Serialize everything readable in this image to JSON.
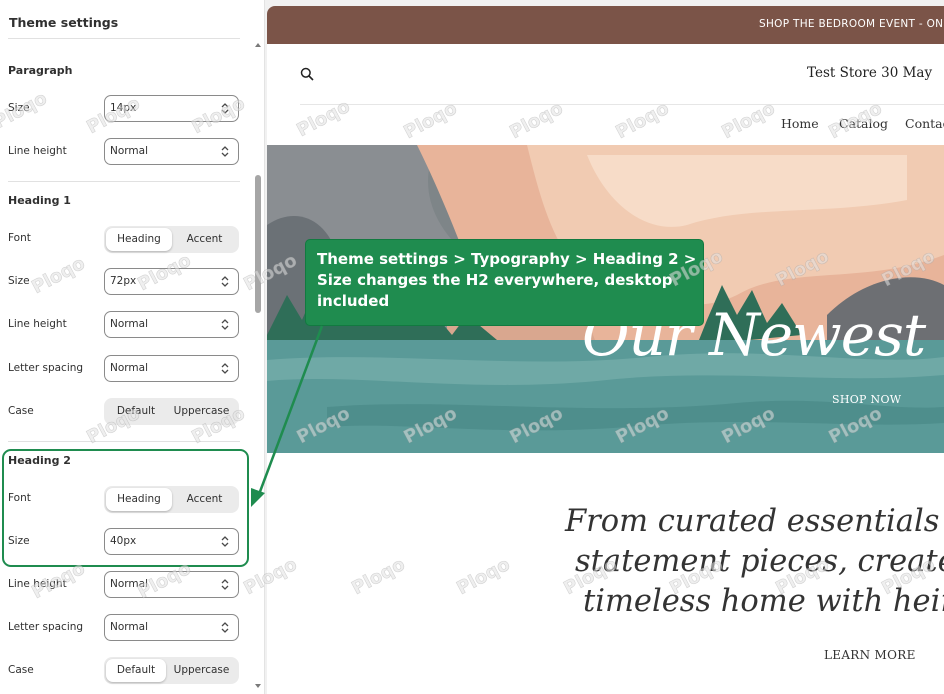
{
  "panel": {
    "title": "Theme settings",
    "paragraph": {
      "title": "Paragraph",
      "size_label": "Size",
      "size_value": "14px",
      "line_height_label": "Line height",
      "line_height_value": "Normal"
    },
    "heading1": {
      "title": "Heading 1",
      "font_label": "Font",
      "font_options": [
        "Heading",
        "Accent"
      ],
      "font_selected": "Heading",
      "size_label": "Size",
      "size_value": "72px",
      "line_height_label": "Line height",
      "line_height_value": "Normal",
      "letter_spacing_label": "Letter spacing",
      "letter_spacing_value": "Normal",
      "case_label": "Case",
      "case_options": [
        "Default",
        "Uppercase"
      ]
    },
    "heading2": {
      "title": "Heading 2",
      "font_label": "Font",
      "font_options": [
        "Heading",
        "Accent"
      ],
      "font_selected": "Heading",
      "size_label": "Size",
      "size_value": "40px",
      "line_height_label": "Line height",
      "line_height_value": "Normal",
      "letter_spacing_label": "Letter spacing",
      "letter_spacing_value": "Normal",
      "case_label": "Case",
      "case_options": [
        "Default",
        "Uppercase"
      ],
      "case_selected": "Default"
    }
  },
  "preview": {
    "announcement": "SHOP THE BEDROOM EVENT - ON",
    "store_title": "Test Store 30 May",
    "nav": [
      "Home",
      "Catalog",
      "Contac"
    ],
    "hero_title": "Our Newest C",
    "hero_cta": "SHOP NOW",
    "tagline": [
      "From curated essentials to th",
      "statement pieces, create the j",
      "timeless home with heirloon"
    ],
    "learn_more": "LEARN MORE"
  },
  "callout": {
    "text": "Theme settings > Typography > Heading 2 > Size changes the H2 everywhere, desktop included"
  },
  "watermark": "Ploqo",
  "colors": {
    "announcement_bg": "#7b5448",
    "callout_green": "#1f8c4f",
    "hero_sea": "#5a9a98",
    "hero_sand": "#e8b49a"
  }
}
